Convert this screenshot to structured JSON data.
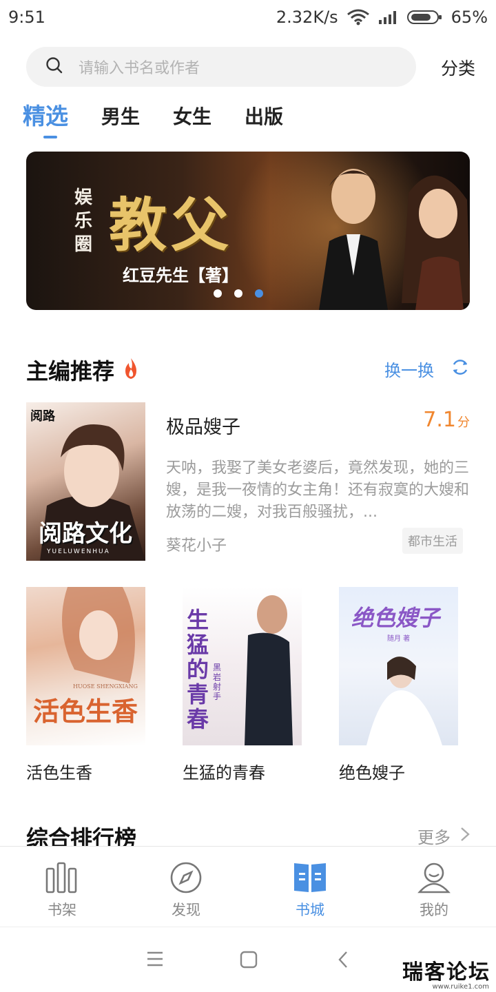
{
  "status_bar": {
    "time": "9:51",
    "network_speed": "2.32K/s",
    "battery": "65%"
  },
  "search": {
    "placeholder": "请输入书名或作者",
    "category_label": "分类"
  },
  "tabs": [
    {
      "label": "精选",
      "active": true
    },
    {
      "label": "男生",
      "active": false
    },
    {
      "label": "女生",
      "active": false
    },
    {
      "label": "出版",
      "active": false
    }
  ],
  "banner": {
    "sub_title": "娱乐圈",
    "title": "教父",
    "author": "红豆先生【著】",
    "page_count": 3,
    "active_index": 2
  },
  "editor_picks": {
    "title": "主编推荐",
    "refresh_label": "换一换",
    "featured": {
      "cover_logo": "阅路",
      "cover_brand": "阅路文化",
      "cover_brand_sub": "YUELUWENHUA",
      "title": "极品嫂子",
      "score": "7.1",
      "score_unit": "分",
      "description": "天呐，我娶了美女老婆后，竟然发现，她的三嫂，是我一夜情的女主角！还有寂寞的大嫂和放荡的二嫂，对我百般骚扰，...",
      "author": "葵花小子",
      "tag": "都市生活"
    },
    "books": [
      {
        "title": "活色生香",
        "cover_text": "活色生香",
        "cover_sub": "HUOSE SHENGXIANG"
      },
      {
        "title": "生猛的青春",
        "cover_text": "生猛的青春",
        "cover_sub": "黑岩射手"
      },
      {
        "title": "绝色嫂子",
        "cover_text": "绝色嫂子",
        "cover_sub": "随月 著"
      }
    ]
  },
  "ranking": {
    "title": "综合排行榜",
    "more_label": "更多"
  },
  "bottom_nav": [
    {
      "label": "书架",
      "icon": "bookshelf-icon",
      "active": false
    },
    {
      "label": "发现",
      "icon": "compass-icon",
      "active": false
    },
    {
      "label": "书城",
      "icon": "book-store-icon",
      "active": true
    },
    {
      "label": "我的",
      "icon": "user-icon",
      "active": false
    }
  ],
  "watermark": {
    "text": "瑞客论坛",
    "url": "www.ruike1.com"
  },
  "colors": {
    "accent": "#4a90e2",
    "score": "#f0862e",
    "hot": "#f0552e"
  }
}
